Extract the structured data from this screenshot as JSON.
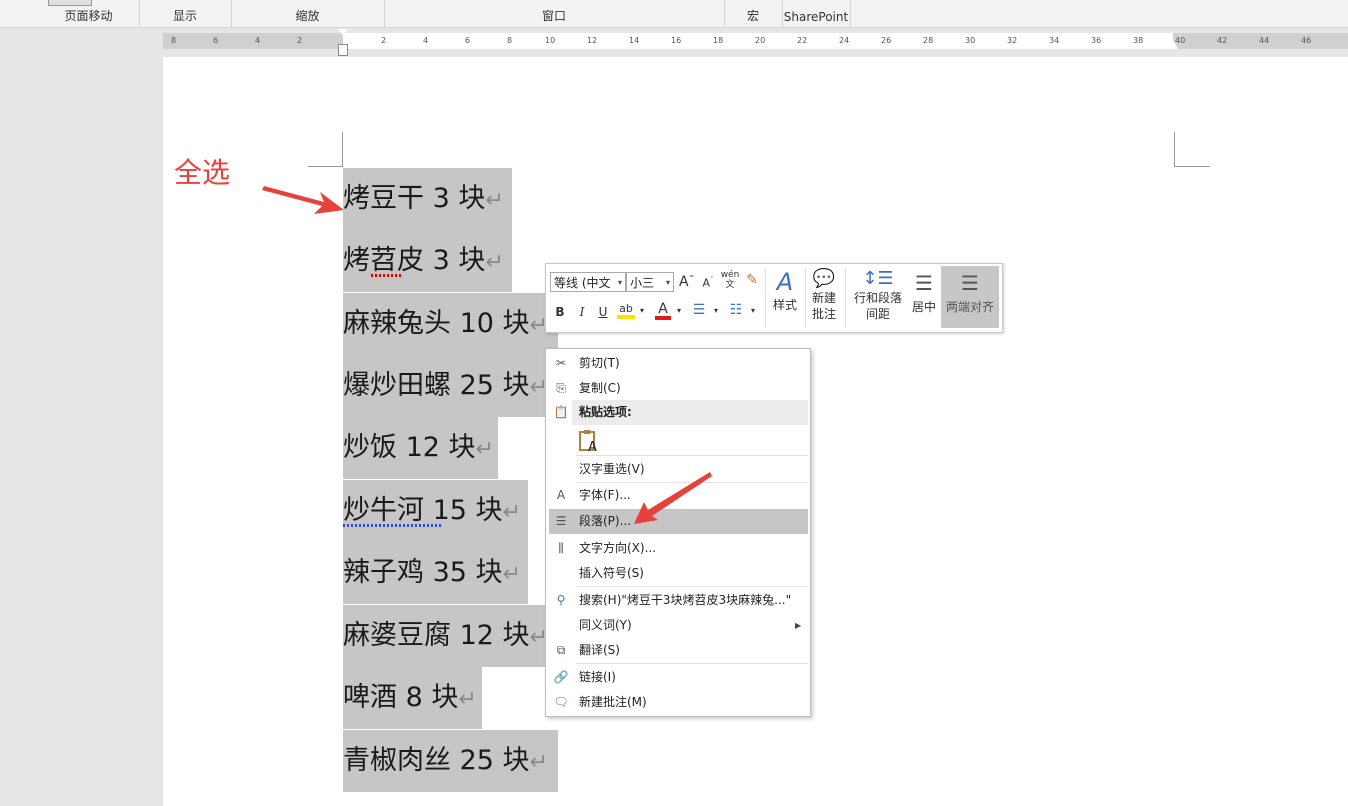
{
  "ribbon": {
    "groups": [
      "页面移动",
      "显示",
      "缩放",
      "窗口",
      "宏",
      "SharePoint"
    ]
  },
  "ruler": {
    "ticks": [
      "8",
      "6",
      "4",
      "2",
      "2",
      "4",
      "6",
      "8",
      "10",
      "12",
      "14",
      "16",
      "18",
      "20",
      "22",
      "24",
      "26",
      "28",
      "30",
      "32",
      "34",
      "36",
      "38",
      "40",
      "42",
      "44",
      "46"
    ]
  },
  "annotation": "全选",
  "document": {
    "lines": [
      {
        "text": "烤豆干 3 块"
      },
      {
        "text": "烤苕皮 3 块"
      },
      {
        "text": "麻辣兔头 10 块"
      },
      {
        "text": "爆炒田螺 25 块"
      },
      {
        "text": "炒饭 12 块"
      },
      {
        "text": "炒牛河 15 块"
      },
      {
        "text": "辣子鸡 35 块"
      },
      {
        "text": "麻婆豆腐 12 块"
      },
      {
        "text": "啤酒 8 块"
      },
      {
        "text": "青椒肉丝 25 块"
      }
    ],
    "paragraph_mark": "↵"
  },
  "mini_toolbar": {
    "font_name": "等线 (中文",
    "font_size": "小三",
    "grow_font": "A",
    "shrink_font": "A",
    "phonetic": "wén",
    "bold": "B",
    "italic": "I",
    "underline": "U",
    "font_color_letter": "A",
    "styles_label": "样式",
    "new_comment_label_1": "新建",
    "new_comment_label_2": "批注",
    "line_spacing_label_1": "行和段落",
    "line_spacing_label_2": "间距",
    "center_label": "居中",
    "justify_label": "两端对齐"
  },
  "context_menu": {
    "cut": "剪切(T)",
    "copy": "复制(C)",
    "paste_options": "粘贴选项:",
    "hanzi_reselect": "汉字重选(V)",
    "font": "字体(F)...",
    "paragraph": "段落(P)...",
    "text_direction": "文字方向(X)...",
    "insert_symbol": "插入符号(S)",
    "search": "搜索(H)\"烤豆干3块烤苕皮3块麻辣兔...\"",
    "synonyms": "同义词(Y)",
    "translate": "翻译(S)",
    "link": "链接(I)",
    "new_comment": "新建批注(M)"
  },
  "colors": {
    "annotation_red": "#e8403a",
    "selection_gray": "#c6c6c6"
  }
}
